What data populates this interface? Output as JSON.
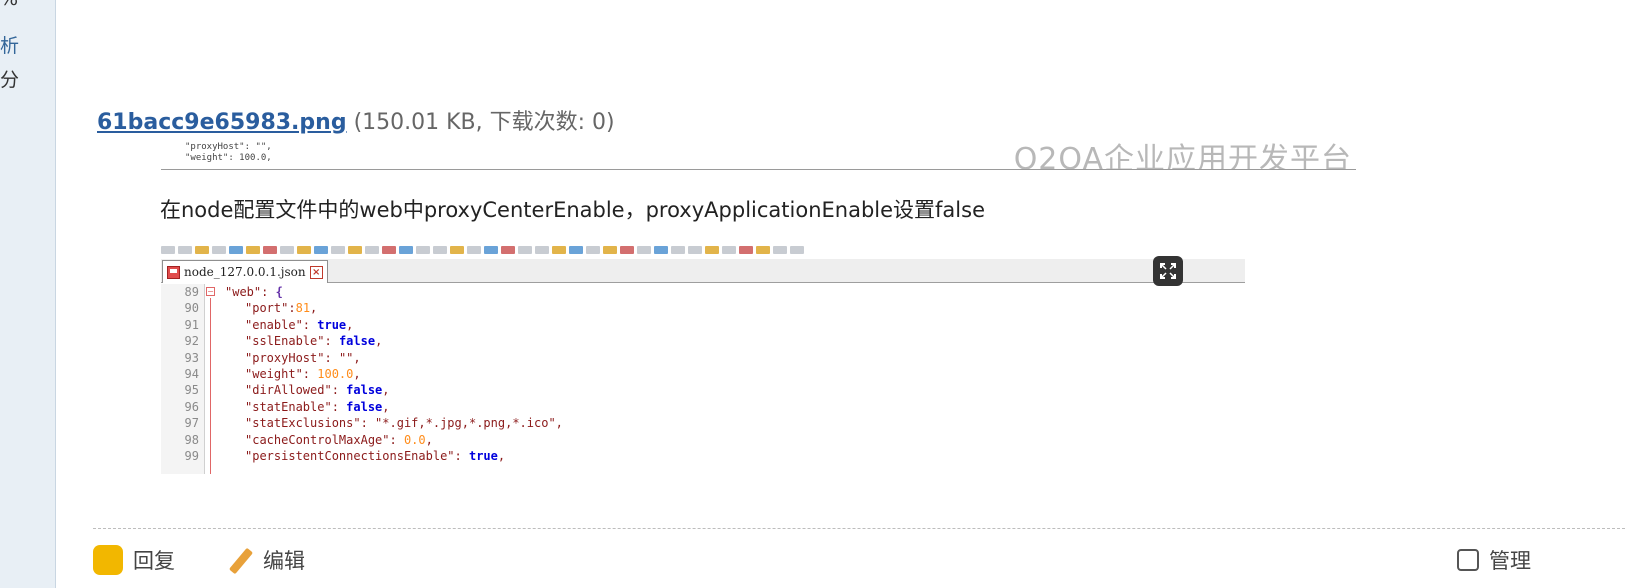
{
  "sidebar": {
    "items": [
      {
        "text": "%",
        "link": false
      },
      {
        "text": "析",
        "link": true
      },
      {
        "text": "分",
        "link": false
      }
    ]
  },
  "attachment": {
    "filename": "61bacc9e65983.png",
    "meta": "(150.01 KB, 下载次数: 0)"
  },
  "top_snippet": {
    "code_lines": [
      "\"proxyHost\": \"\",",
      "\"weight\": 100.0,"
    ],
    "watermark": "O2OA企业应用开发平台"
  },
  "paragraph": "在node配置文件中的web中proxyCenterEnable，proxyApplicationEnable设置false",
  "editor": {
    "tab_label": "node_127.0.0.1.json",
    "lines": [
      {
        "no": "89",
        "key": "\"web\"",
        "sep": ": ",
        "val": "{",
        "type": "punct"
      },
      {
        "no": "90",
        "key": "\"port\"",
        "sep": ":",
        "val": "81",
        "type": "num"
      },
      {
        "no": "91",
        "key": "\"enable\"",
        "sep": ": ",
        "val": "true",
        "type": "kw"
      },
      {
        "no": "92",
        "key": "\"sslEnable\"",
        "sep": ": ",
        "val": "false",
        "type": "kw"
      },
      {
        "no": "93",
        "key": "\"proxyHost\"",
        "sep": ": ",
        "val": "\"\"",
        "type": "str"
      },
      {
        "no": "94",
        "key": "\"weight\"",
        "sep": ": ",
        "val": "100.0",
        "type": "num"
      },
      {
        "no": "95",
        "key": "\"dirAllowed\"",
        "sep": ": ",
        "val": "false",
        "type": "kw"
      },
      {
        "no": "96",
        "key": "\"statEnable\"",
        "sep": ": ",
        "val": "false",
        "type": "kw"
      },
      {
        "no": "97",
        "key": "\"statExclusions\"",
        "sep": ": ",
        "val": "\"*.gif,*.jpg,*.png,*.ico\"",
        "type": "str"
      },
      {
        "no": "98",
        "key": "\"cacheControlMaxAge\"",
        "sep": ": ",
        "val": "0.0",
        "type": "num"
      },
      {
        "no": "99",
        "key": "\"persistentConnectionsEnable\"",
        "sep": ": ",
        "val": "true",
        "type": "kw"
      }
    ]
  },
  "actions": {
    "reply": "回复",
    "edit": "编辑",
    "manage": "管理"
  },
  "icons": {
    "reply": "reply-icon",
    "edit": "pencil-icon",
    "manage": "checkbox-icon",
    "expand": "expand-icon"
  }
}
